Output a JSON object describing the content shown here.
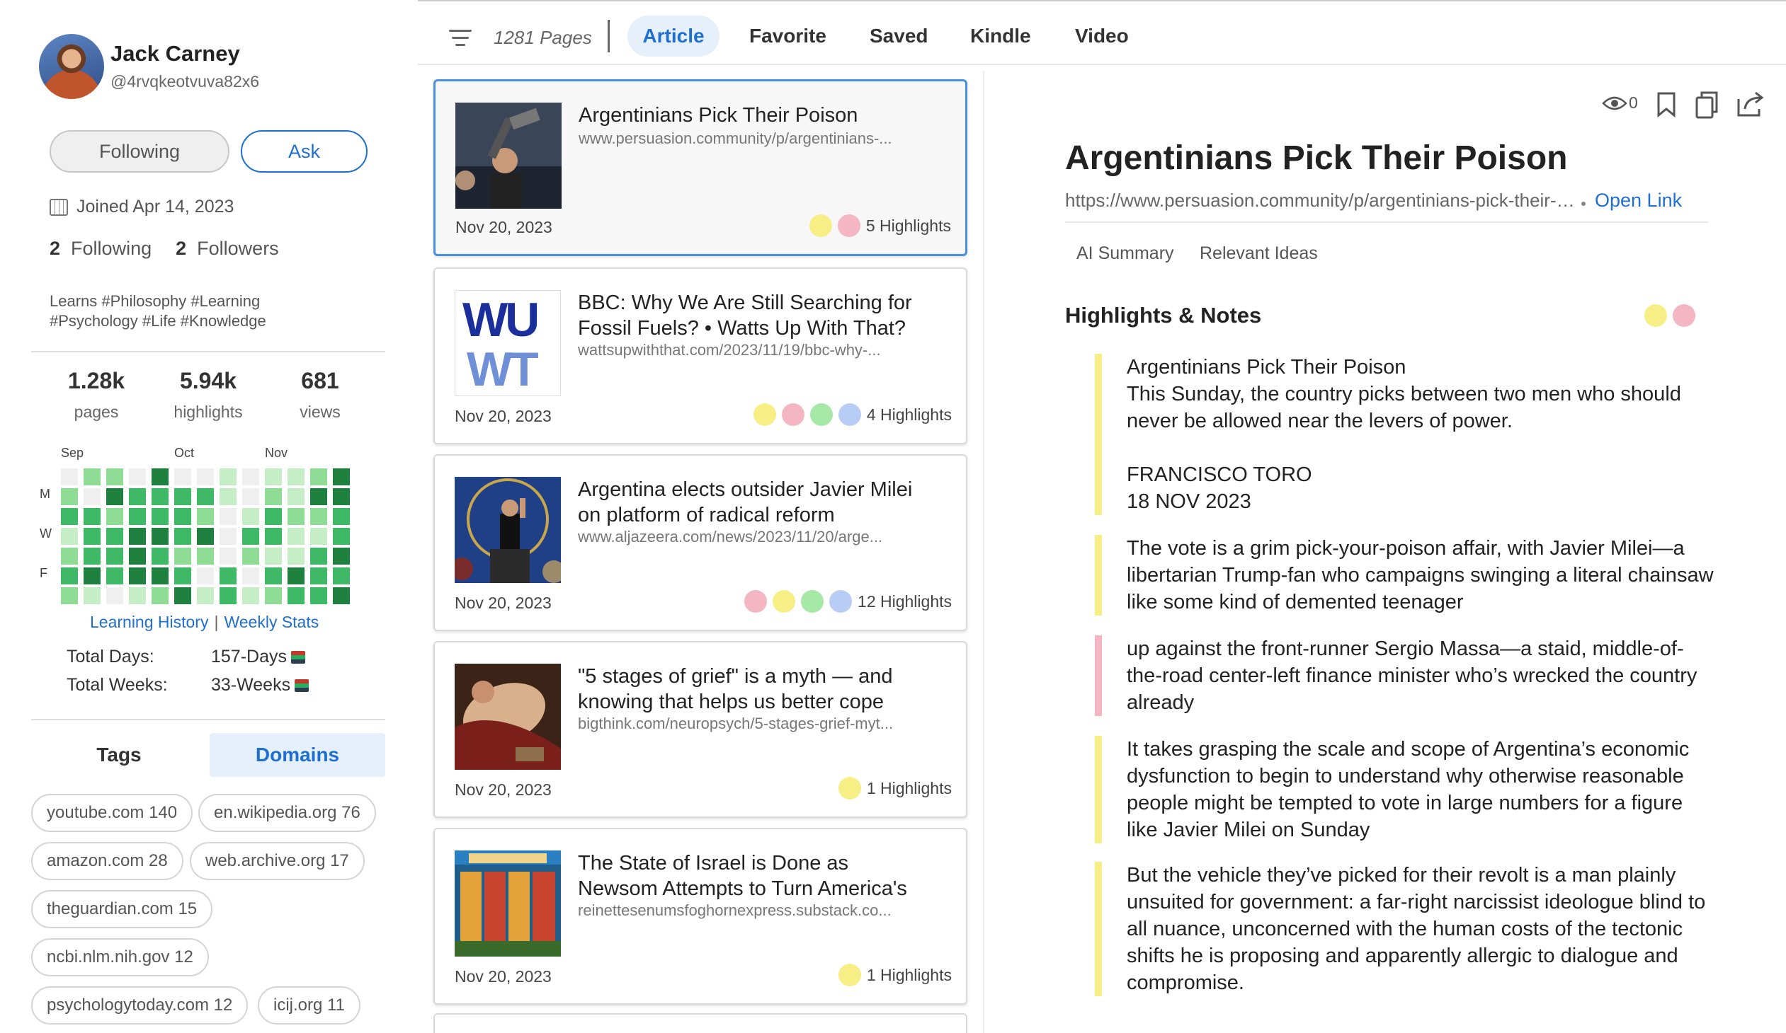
{
  "profile": {
    "name": "Jack Carney",
    "handle": "@4rvqkeotvuva82x6",
    "following_btn": "Following",
    "ask_btn": "Ask",
    "joined": "Joined Apr 14, 2023",
    "following_count": "2",
    "following_label": "Following",
    "followers_count": "2",
    "followers_label": "Followers",
    "learns": "Learns #Philosophy #Learning #Psychology #Life #Knowledge"
  },
  "stats": [
    {
      "value": "1.28k",
      "label": "pages"
    },
    {
      "value": "5.94k",
      "label": "highlights"
    },
    {
      "value": "681",
      "label": "views"
    }
  ],
  "heatmap": {
    "months": [
      "Sep",
      "Oct",
      "Nov"
    ],
    "days": [
      "M",
      "W",
      "F"
    ],
    "colors": [
      "#efefef",
      "#c6eec6",
      "#8fdc97",
      "#3fb868",
      "#1f7f3e"
    ],
    "levels": [
      [
        0,
        2,
        2,
        0,
        4,
        0,
        0,
        1,
        0,
        1,
        1,
        2,
        4
      ],
      [
        2,
        0,
        4,
        3,
        3,
        3,
        3,
        1,
        0,
        2,
        1,
        4,
        4
      ],
      [
        3,
        3,
        2,
        3,
        3,
        3,
        2,
        0,
        1,
        3,
        2,
        2,
        3
      ],
      [
        1,
        3,
        3,
        4,
        4,
        3,
        4,
        0,
        3,
        3,
        1,
        1,
        3
      ],
      [
        2,
        3,
        3,
        4,
        3,
        2,
        2,
        0,
        2,
        1,
        1,
        3,
        4
      ],
      [
        3,
        4,
        3,
        4,
        4,
        3,
        0,
        3,
        0,
        3,
        4,
        3,
        3
      ],
      [
        2,
        1,
        0,
        1,
        2,
        4,
        1,
        3,
        1,
        2,
        3,
        3,
        4
      ]
    ]
  },
  "links": {
    "history": "Learning History",
    "sep": "|",
    "weekly": "Weekly Stats"
  },
  "totals": {
    "days_label": "Total Days:",
    "days_value": "157-Days",
    "weeks_label": "Total Weeks:",
    "weeks_value": "33-Weeks"
  },
  "side_tabs": {
    "tags": "Tags",
    "domains": "Domains"
  },
  "domains": [
    "youtube.com 140",
    "en.wikipedia.org 76",
    "amazon.com 28",
    "web.archive.org 17",
    "theguardian.com 15",
    "ncbi.nlm.nih.gov 12",
    "psychologytoday.com 12",
    "icij.org 11"
  ],
  "toolbar": {
    "pages_count": "1281 Pages",
    "tabs": [
      "Article",
      "Favorite",
      "Saved",
      "Kindle",
      "Video"
    ]
  },
  "highlight_colors": {
    "yellow": "#f7ef86",
    "pink": "#f5b6c3",
    "green": "#a6e9a6",
    "blue": "#b8cdf6"
  },
  "cards": [
    {
      "title": "Argentinians Pick Their Poison",
      "url": "www.persuasion.community/p/argentinians-...",
      "date": "Nov 20, 2023",
      "highlights": "5 Highlights",
      "dots": [
        "yellow",
        "pink"
      ]
    },
    {
      "title": "BBC: Why We Are Still Searching for Fossil Fuels? • Watts Up With That?",
      "url": "wattsupwiththat.com/2023/11/19/bbc-why-...",
      "date": "Nov 20, 2023",
      "highlights": "4 Highlights",
      "dots": [
        "yellow",
        "pink",
        "green",
        "blue"
      ]
    },
    {
      "title": "Argentina elects outsider Javier Milei on platform of radical reform",
      "url": "www.aljazeera.com/news/2023/11/20/arge...",
      "date": "Nov 20, 2023",
      "highlights": "12 Highlights",
      "dots": [
        "pink",
        "yellow",
        "green",
        "blue"
      ]
    },
    {
      "title": "\"5 stages of grief\" is a myth — and knowing that helps us better cope",
      "url": "bigthink.com/neuropsych/5-stages-grief-myt...",
      "date": "Nov 20, 2023",
      "highlights": "1 Highlights",
      "dots": [
        "yellow"
      ]
    },
    {
      "title": "The State of Israel is Done as Newsom Attempts to Turn America's",
      "url": "reinettesenumsfoghornexpress.substack.co...",
      "date": "Nov 20, 2023",
      "highlights": "1 Highlights",
      "dots": [
        "yellow"
      ]
    }
  ],
  "thumb_text": {
    "wuwt_top": "WU",
    "wuwt_bottom": "WT"
  },
  "article": {
    "views": "0",
    "title": "Argentinians Pick Their Poison",
    "url": "https://www.persuasion.community/p/argentinians-pick-their-poison",
    "open_link": "Open Link",
    "subtabs": [
      "AI Summary",
      "Relevant Ideas"
    ],
    "hn_title": "Highlights & Notes",
    "highlights": [
      {
        "color": "yellow",
        "text": "Argentinians Pick Their Poison\nThis Sunday, the country picks between two men who should never be allowed near the levers of power.\n\nFRANCISCO TORO\n18 NOV 2023"
      },
      {
        "color": "yellow",
        "text": "The vote is a grim pick-your-poison affair, with Javier Milei—a libertarian Trump-fan who campaigns swinging a literal chainsaw like some kind of demented teenager"
      },
      {
        "color": "pink",
        "text": "up against the front-runner Sergio Massa—a staid, middle-of-the-road center-left finance minister who’s wrecked the country already"
      },
      {
        "color": "yellow",
        "text": "It takes grasping the scale and scope of Argentina’s economic dysfunction to begin to understand why otherwise reasonable people might be tempted to vote in large numbers for a figure like Javier Milei on Sunday"
      },
      {
        "color": "yellow",
        "text": "But the vehicle they’ve picked for their revolt is a man plainly unsuited for government: a far-right narcissist ideologue blind to all nuance, unconcerned with the human costs of the tectonic shifts he is proposing and apparently allergic to dialogue and compromise."
      }
    ]
  }
}
